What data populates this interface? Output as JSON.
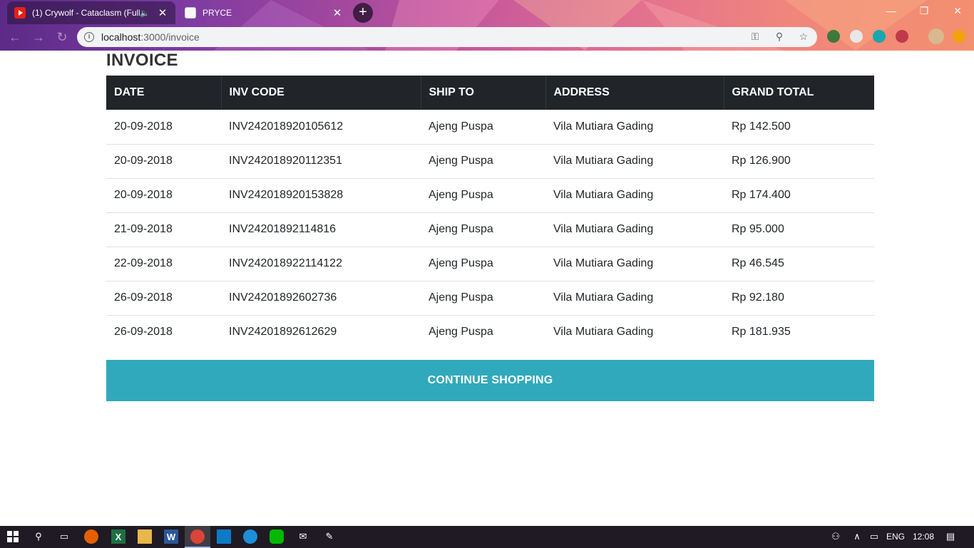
{
  "browser": {
    "tabs": [
      {
        "title": "(1) Crywolf - Cataclasm (Full",
        "audio": "🔈",
        "close": "✕"
      },
      {
        "title": "PRYCE",
        "close": "✕"
      }
    ],
    "new_tab": "+",
    "window_controls": {
      "minimize": "—",
      "restore": "❐",
      "close": "✕"
    },
    "url_host": "localhost",
    "url_path": ":3000/invoice"
  },
  "page": {
    "title": "INVOICE",
    "table": {
      "headers": [
        "DATE",
        "INV CODE",
        "SHIP TO",
        "ADDRESS",
        "GRAND TOTAL"
      ],
      "rows": [
        [
          "20-09-2018",
          "INV242018920105612",
          "Ajeng Puspa",
          "Vila Mutiara Gading",
          "Rp 142.500"
        ],
        [
          "20-09-2018",
          "INV242018920112351",
          "Ajeng Puspa",
          "Vila Mutiara Gading",
          "Rp 126.900"
        ],
        [
          "20-09-2018",
          "INV242018920153828",
          "Ajeng Puspa",
          "Vila Mutiara Gading",
          "Rp 174.400"
        ],
        [
          "21-09-2018",
          "INV24201892114816",
          "Ajeng Puspa",
          "Vila Mutiara Gading",
          "Rp 95.000"
        ],
        [
          "22-09-2018",
          "INV242018922114122",
          "Ajeng Puspa",
          "Vila Mutiara Gading",
          "Rp 46.545"
        ],
        [
          "26-09-2018",
          "INV24201892602736",
          "Ajeng Puspa",
          "Vila Mutiara Gading",
          "Rp 92.180"
        ],
        [
          "26-09-2018",
          "INV24201892612629",
          "Ajeng Puspa",
          "Vila Mutiara Gading",
          "Rp 181.935"
        ]
      ]
    },
    "continue_button": "CONTINUE SHOPPING"
  },
  "taskbar": {
    "language": "ENG",
    "time": "12:08"
  },
  "colors": {
    "table_header_bg": "#212529",
    "button_bg": "#31a9bc"
  }
}
